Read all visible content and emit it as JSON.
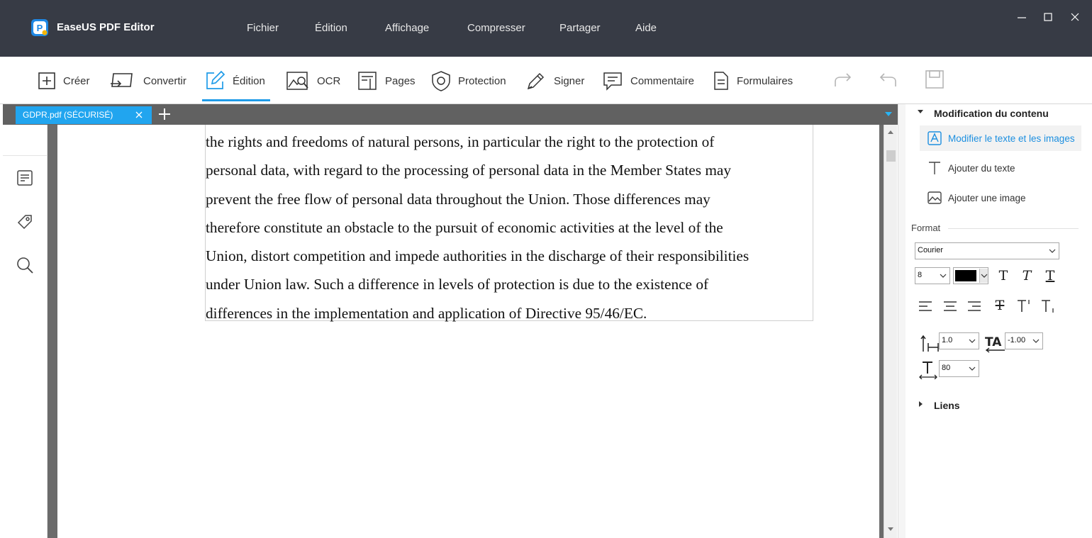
{
  "app": {
    "title": "EaseUS PDF Editor"
  },
  "menu": [
    "Fichier",
    "Édition",
    "Affichage",
    "Compresser",
    "Partager",
    "Aide"
  ],
  "toolbar": {
    "create": "Créer",
    "convert": "Convertir",
    "edit": "Édition",
    "ocr": "OCR",
    "pages": "Pages",
    "protection": "Protection",
    "sign": "Signer",
    "comment": "Commentaire",
    "forms": "Formulaires"
  },
  "tab": {
    "label": "GDPR.pdf (SÉCURISÉ)"
  },
  "document": {
    "lines": [
      "the rights and freedoms of natural persons, in particular the right to the protection of",
      "personal data, with regard to the processing of personal data in the Member States may",
      "prevent the free flow of personal data throughout the Union. Those differences may",
      "therefore constitute an obstacle to the pursuit of economic activities at the level of the",
      "Union, distort competition and impede authorities in the discharge of their responsibilities",
      "under Union law. Such a difference in levels of protection is due to the existence of",
      "differences in the implementation and application of Directive 95/46/EC."
    ]
  },
  "panel": {
    "content_title": "Modification du contenu",
    "edit_text_images": "Modifier le texte et les images",
    "add_text": "Ajouter du texte",
    "add_image": "Ajouter une image",
    "format_label": "Format",
    "font": "Courier",
    "font_size": "8",
    "text_color": "#000000",
    "line_spacing": "1.0",
    "char_spacing": "-1.00",
    "scale": "80",
    "links_title": "Liens"
  },
  "colors": {
    "titlebar": "#373b45",
    "accent": "#1e9be8",
    "tab": "#21a5ef"
  }
}
